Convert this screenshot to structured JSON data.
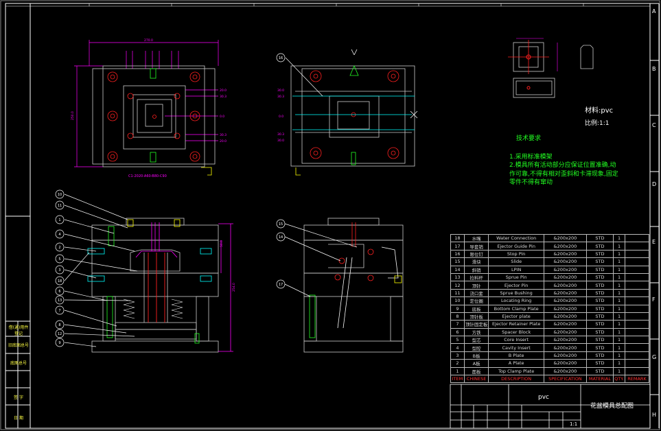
{
  "colors": {
    "frame": "#ffffff",
    "outline": "#cccccc",
    "dimension": "#ff00ff",
    "accent_red": "#ff2020",
    "accent_green": "#22ff22",
    "accent_yellow": "#ffff00",
    "accent_cyan": "#00ffff"
  },
  "drawing": {
    "material": "材料:pvc",
    "scale": "比例:1:1",
    "section_label": "C1-2020-A60-B80-C90"
  },
  "tech_requirements": {
    "title": "技术要求",
    "items": [
      "1.采用标准模架",
      "2.模具所有活动部分应保证位置准确,动作可靠,不得有相对歪斜和卡滞现象,固定零件不得有窜动"
    ]
  },
  "bom": {
    "rows": [
      {
        "no": "18",
        "cn": "水嘴",
        "en": "Water Connection",
        "spec": "&200x200",
        "mat": "STD",
        "qty": "1"
      },
      {
        "no": "17",
        "cn": "导套销",
        "en": "Ejector Guide Pin",
        "spec": "&200x200",
        "mat": "STD",
        "qty": "1"
      },
      {
        "no": "16",
        "cn": "限位钉",
        "en": "Stop Pin",
        "spec": "&200x200",
        "mat": "STD",
        "qty": "1"
      },
      {
        "no": "15",
        "cn": "滑块",
        "en": "Slide",
        "spec": "&200x200",
        "mat": "STD",
        "qty": "1"
      },
      {
        "no": "14",
        "cn": "斜销",
        "en": "LPIN",
        "spec": "&200x200",
        "mat": "STD",
        "qty": "1"
      },
      {
        "no": "13",
        "cn": "拉料杆",
        "en": "Sprue Pin",
        "spec": "&200x200",
        "mat": "STD",
        "qty": "1"
      },
      {
        "no": "12",
        "cn": "顶针",
        "en": "Ejector Pin",
        "spec": "&200x200",
        "mat": "STD",
        "qty": "1"
      },
      {
        "no": "11",
        "cn": "浇口套",
        "en": "Sprue Bushing",
        "spec": "&200x200",
        "mat": "STD",
        "qty": "1"
      },
      {
        "no": "10",
        "cn": "定位圈",
        "en": "Locating Ring",
        "spec": "&200x200",
        "mat": "STD",
        "qty": "1"
      },
      {
        "no": "9",
        "cn": "底板",
        "en": "Bottom Clamp Plate",
        "spec": "&200x200",
        "mat": "STD",
        "qty": "1"
      },
      {
        "no": "8",
        "cn": "顶针板",
        "en": "Ejector plate",
        "spec": "&200x200",
        "mat": "STD",
        "qty": "1"
      },
      {
        "no": "7",
        "cn": "顶针固定板",
        "en": "Ejector Retainer Plate",
        "spec": "&200x200",
        "mat": "STD",
        "qty": "1"
      },
      {
        "no": "6",
        "cn": "方铁",
        "en": "Spacer Block",
        "spec": "&200x200",
        "mat": "STD",
        "qty": "1"
      },
      {
        "no": "5",
        "cn": "型芯",
        "en": "Core Insert",
        "spec": "&200x200",
        "mat": "STD",
        "qty": "1"
      },
      {
        "no": "4",
        "cn": "型腔",
        "en": "Cavity Insert",
        "spec": "&200x200",
        "mat": "STD",
        "qty": "1"
      },
      {
        "no": "3",
        "cn": "B板",
        "en": "B Plate",
        "spec": "&200x200",
        "mat": "STD",
        "qty": "1"
      },
      {
        "no": "2",
        "cn": "A板",
        "en": "A Plate",
        "spec": "&200x200",
        "mat": "STD",
        "qty": "1"
      },
      {
        "no": "1",
        "cn": "面板",
        "en": "Top Clamp Plate",
        "spec": "&200x200",
        "mat": "STD",
        "qty": "1"
      }
    ],
    "header": [
      "ITEM",
      "CHINESE",
      "DESCRIPTION",
      "SPECIFICATION",
      "MATERIAL",
      "QTY.",
      "REMARK"
    ]
  },
  "title_block": {
    "material": "pvc",
    "drawing_name": "花盆模具总配图",
    "scale": "1:1"
  },
  "border": {
    "row_letters": [
      "A",
      "B",
      "C",
      "D",
      "E",
      "F",
      "G",
      "H"
    ]
  },
  "left_margin_labels": [
    "借(通)用件登记",
    "旧底图总号",
    "底图总号",
    "签 字",
    "日 期"
  ],
  "balloons": {
    "front_view": [
      "10",
      "11",
      "1",
      "4",
      "2",
      "5",
      "3",
      "18",
      "6",
      "13",
      "7",
      "8",
      "12",
      "9"
    ],
    "side_view": [
      "15",
      "14",
      "17"
    ],
    "top_right_view": "16"
  }
}
